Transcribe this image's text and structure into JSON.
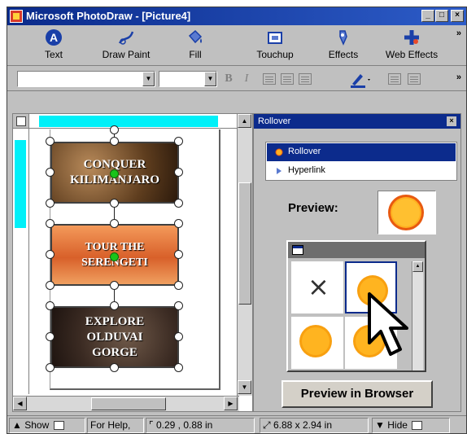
{
  "window": {
    "title": "Microsoft PhotoDraw - [Picture4]",
    "controls": {
      "minimize": "_",
      "maximize": "□",
      "close": "×"
    }
  },
  "toolbar": {
    "buttons": [
      {
        "label": "Text",
        "icon": "text-icon"
      },
      {
        "label": "Draw Paint",
        "icon": "draw-paint-icon"
      },
      {
        "label": "Fill",
        "icon": "fill-icon"
      },
      {
        "label": "Touchup",
        "icon": "touchup-icon"
      },
      {
        "label": "Effects",
        "icon": "effects-icon"
      },
      {
        "label": "Web Effects",
        "icon": "web-effects-icon"
      }
    ],
    "overflow": "»"
  },
  "format_toolbar": {
    "font_value": "",
    "size_value": "",
    "bold": "B",
    "italic": "I"
  },
  "canvas": {
    "graphics": [
      {
        "line1": "CONQUER",
        "line2": "KILIMANJARO",
        "line3": ""
      },
      {
        "line1": "TOUR THE",
        "line2": "SERENGETI",
        "line3": ""
      },
      {
        "line1": "EXPLORE",
        "line2": "OLDUVAI",
        "line3": "GORGE"
      }
    ]
  },
  "rollover_panel": {
    "title": "Rollover",
    "close": "×",
    "items": [
      {
        "label": "Rollover",
        "selected": true
      },
      {
        "label": "Hyperlink",
        "selected": false
      }
    ],
    "preview_label": "Preview:",
    "grid_close_glyph": "×",
    "preview_button": "Preview in Browser"
  },
  "statusbar": {
    "show": "Show",
    "help": "For Help,",
    "position": "0.29 , 0.88  in",
    "size": "6.88 x 2.94  in",
    "hide": "Hide"
  },
  "colors": {
    "titlebar": "#0a2a8a",
    "selection": "#0c2b8c",
    "ruler_highlight": "#00f0f8",
    "rollover_fill": "#ffb020",
    "rollover_ring": "#e85a10",
    "handle_green": "#19c419"
  }
}
